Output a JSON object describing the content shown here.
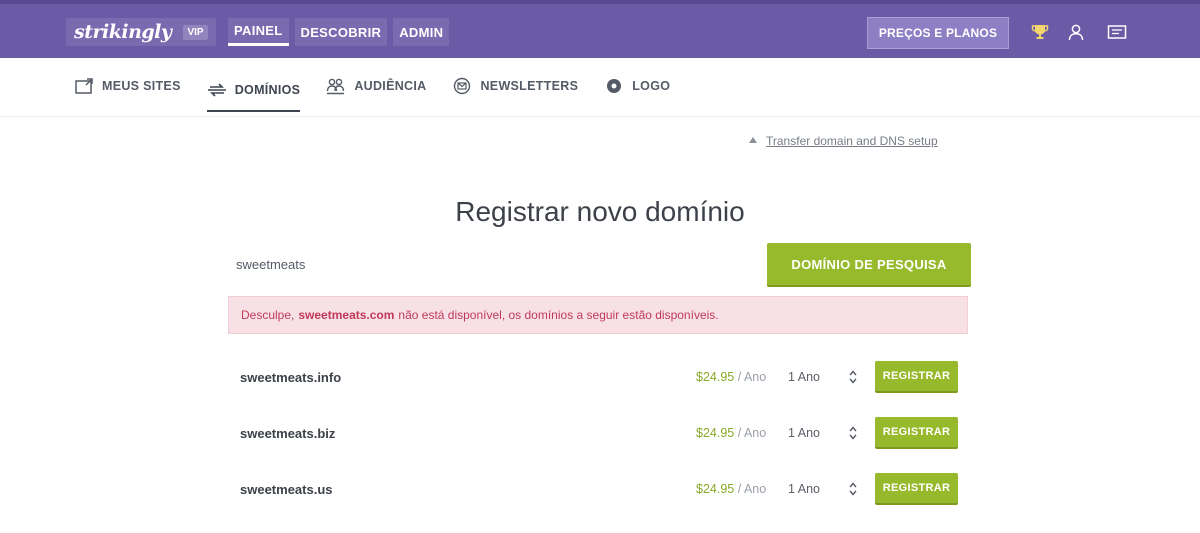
{
  "header": {
    "logo_text": "strikingly",
    "logo_badge": "VIP",
    "nav": [
      {
        "label": "PAINEL"
      },
      {
        "label": "DESCOBRIR"
      },
      {
        "label": "ADMIN"
      }
    ],
    "upgrade_label": "PREÇOS E PLANOS",
    "icons": [
      "trophy-icon",
      "user-icon",
      "messages-icon"
    ]
  },
  "subnav": {
    "items": [
      {
        "label": "MEUS SITES",
        "icon": "sites-icon"
      },
      {
        "label": "DOMÍNIOS",
        "icon": "domains-icon"
      },
      {
        "label": "AUDIÊNCIA",
        "icon": "audience-icon"
      },
      {
        "label": "NEWSLETTERS",
        "icon": "newsletters-icon"
      },
      {
        "label": "LOGO",
        "icon": "logo-icon"
      }
    ]
  },
  "transfer_link": "Transfer domain and DNS setup",
  "page_title": "Registrar novo domínio",
  "search": {
    "value": "sweetmeats",
    "button_label": "DOMÍNIO DE PESQUISA"
  },
  "alert": {
    "prefix": "Desculpe,",
    "domain": "sweetmeats.com",
    "suffix": "não está disponível, os domínios a seguir estão disponíveis."
  },
  "results": [
    {
      "domain": "sweetmeats.info",
      "price": "$24.95",
      "unit": "/ Ano",
      "period": "1 Ano",
      "register_label": "REGISTRAR"
    },
    {
      "domain": "sweetmeats.biz",
      "price": "$24.95",
      "unit": "/ Ano",
      "period": "1 Ano",
      "register_label": "REGISTRAR"
    },
    {
      "domain": "sweetmeats.us",
      "price": "$24.95",
      "unit": "/ Ano",
      "period": "1 Ano",
      "register_label": "REGISTRAR"
    }
  ],
  "colors": {
    "header": "#6b5aa6",
    "accent_green": "#96ba2b",
    "alert_bg": "#f8e1e6",
    "alert_text": "#c03a58"
  }
}
